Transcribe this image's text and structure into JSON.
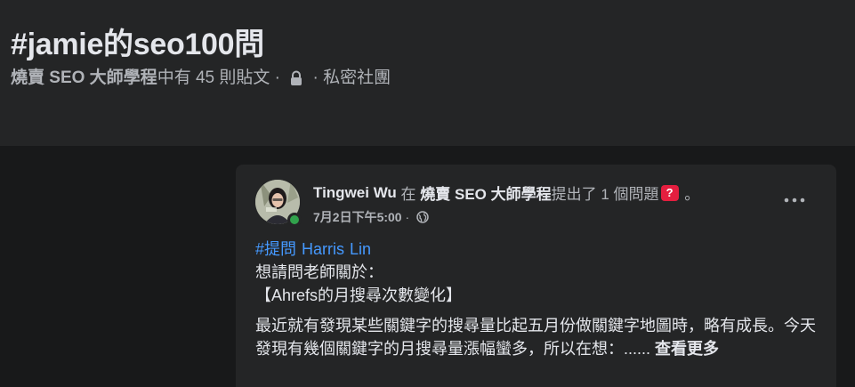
{
  "hashtag_page": {
    "title": "#jamie的seo100問",
    "group_name": "燒賣 SEO 大師學程",
    "post_count_text": "中有 45 則貼文 · ",
    "privacy_text": " · 私密社團"
  },
  "post": {
    "author": "Tingwei Wu",
    "in_text": " 在 ",
    "group": "燒賣 SEO 大師學程",
    "action_text": "提出了 1 個問題",
    "badge": "?",
    "trailing": " 。",
    "timestamp": "7月2日下午5:00",
    "separator": " · ",
    "tags": [
      "#提問",
      "Harris",
      "Lin"
    ],
    "line1": "想請問老師關於：",
    "line2": "【Ahrefs的月搜尋次數變化】",
    "paragraph": "最近就有發現某些關鍵字的搜尋量比起五月份做關鍵字地圖時，略有成長。今天發現有幾個關鍵字的月搜尋量漲幅蠻多，所以在想：......",
    "see_more": "查看更多"
  },
  "colors": {
    "page_bg": "#18191a",
    "card_bg": "#242526",
    "link_blue": "#4599ff",
    "badge_red": "#e41e3f",
    "online_green": "#31a24c"
  },
  "icons": [
    "lock-icon",
    "globe-icon",
    "more-options-icon"
  ]
}
